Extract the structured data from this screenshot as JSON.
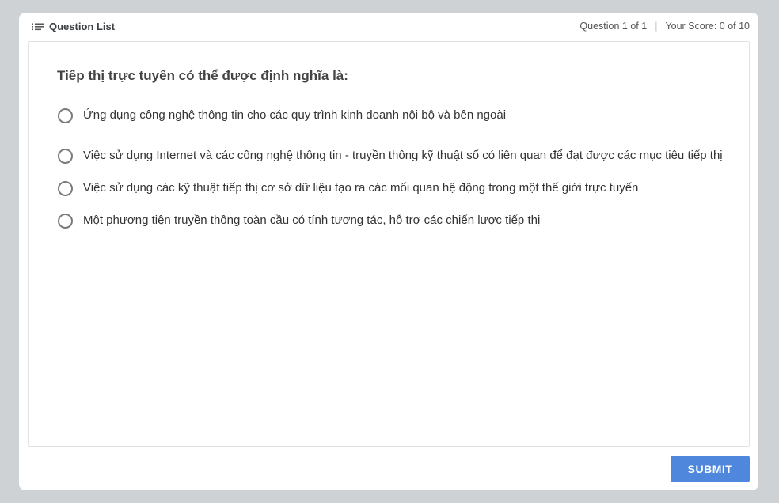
{
  "header": {
    "question_list_label": "Question List",
    "question_counter": "Question 1 of 1",
    "score": "Your Score: 0 of 10",
    "question_list_icon": "list-icon"
  },
  "question": {
    "text": "Tiếp thị trực tuyến có thể được định nghĩa là:",
    "options": [
      {
        "label": "Ứng dụng công nghệ thông tin cho các quy trình kinh doanh nội bộ và bên ngoài",
        "selected": false
      },
      {
        "label": "Việc sử dụng Internet và các công nghệ thông tin - truyền thông kỹ thuật số có liên quan để  đạt được các mục tiêu tiếp thị",
        "selected": false
      },
      {
        "label": "Việc sử dụng các kỹ thuật tiếp thị cơ sở dữ liệu tạo ra các mối quan hệ động trong một thế  giới trực tuyến",
        "selected": false
      },
      {
        "label": "Một phương tiện truyền thông toàn cầu có tính tương tác, hỗ trợ các chiến lược tiếp thị",
        "selected": false
      }
    ]
  },
  "footer": {
    "submit_label": "SUBMIT"
  },
  "colors": {
    "background": "#cfd2d4",
    "accent": "#4f87dc"
  }
}
